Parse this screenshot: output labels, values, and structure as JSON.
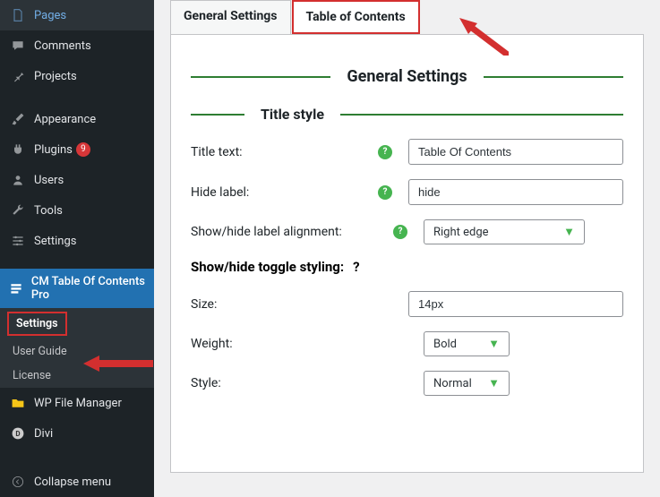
{
  "sidebar": {
    "items": [
      {
        "label": "Pages",
        "icon": "pages"
      },
      {
        "label": "Comments",
        "icon": "comments"
      },
      {
        "label": "Projects",
        "icon": "projects"
      },
      {
        "label": "Appearance",
        "icon": "appearance",
        "spaced": true
      },
      {
        "label": "Plugins",
        "icon": "plugins",
        "badge": "9"
      },
      {
        "label": "Users",
        "icon": "users"
      },
      {
        "label": "Tools",
        "icon": "tools"
      },
      {
        "label": "Settings",
        "icon": "settings"
      },
      {
        "label": "CM Table Of Contents Pro",
        "icon": "cm",
        "active": true,
        "spaced": true
      }
    ],
    "submenu": [
      "Settings",
      "User Guide",
      "License"
    ],
    "post_items": [
      {
        "label": "WP File Manager",
        "icon": "wpfm"
      },
      {
        "label": "Divi",
        "icon": "divi"
      }
    ],
    "collapse": "Collapse menu"
  },
  "tabs": {
    "general": "General Settings",
    "toc": "Table of Contents"
  },
  "panel": {
    "section_title": "General Settings",
    "title_style": "Title style",
    "fields": {
      "title_text": {
        "label": "Title text:",
        "value": "Table Of Contents"
      },
      "hide_label": {
        "label": "Hide label:",
        "value": "hide"
      },
      "alignment": {
        "label": "Show/hide label alignment:",
        "value": "Right edge"
      }
    },
    "toggle_heading": "Show/hide toggle styling:",
    "toggle_fields": {
      "size": {
        "label": "Size:",
        "value": "14px"
      },
      "weight": {
        "label": "Weight:",
        "value": "Bold"
      },
      "style": {
        "label": "Style:",
        "value": "Normal"
      }
    }
  }
}
